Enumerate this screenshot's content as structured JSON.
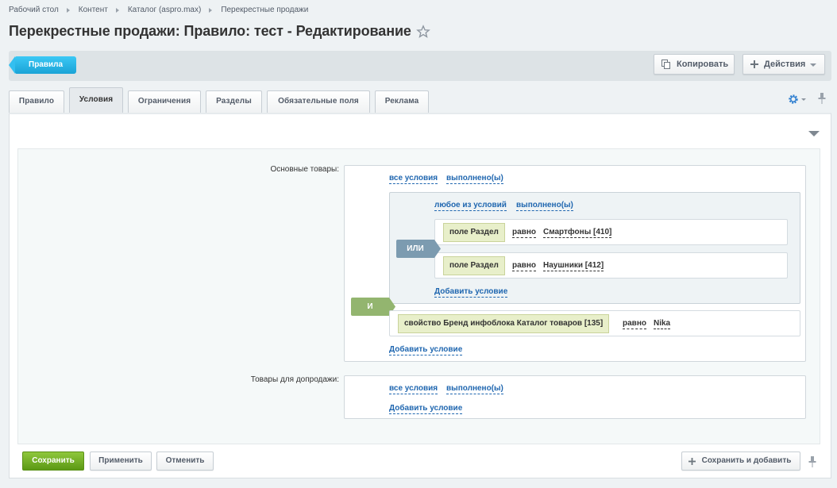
{
  "breadcrumbs": [
    "Рабочий стол",
    "Контент",
    "Каталог (aspro.max)",
    "Перекрестные продажи"
  ],
  "page_title": "Перекрестные продажи: Правило: тест - Редактирование",
  "toolbar": {
    "back_label": "Правила",
    "copy_label": "Копировать",
    "actions_label": "Действия"
  },
  "tabs": [
    "Правило",
    "Условия",
    "Ограничения",
    "Разделы",
    "Обязательные поля",
    "Реклама"
  ],
  "active_tab": "Условия",
  "main_products": {
    "label": "Основные товары:",
    "all_conditions": "все условия",
    "fulfilled": "выполнено(ы)",
    "group": {
      "any_of": "любое из условий",
      "fulfilled": "выполнено(ы)",
      "or_label": "ИЛИ",
      "rows": [
        {
          "field": "поле Раздел",
          "operator": "равно",
          "value": "Смартфоны [410]"
        },
        {
          "field": "поле Раздел",
          "operator": "равно",
          "value": "Наушники [412]"
        }
      ],
      "add_condition": "Добавить условие"
    },
    "and_label": "И",
    "brand_row": {
      "field": "свойство Бренд инфоблока Каталог товаров [135]",
      "operator": "равно",
      "value": "Nika"
    },
    "add_condition": "Добавить условие"
  },
  "upsell_products": {
    "label": "Товары для допродажи:",
    "all_conditions": "все условия",
    "fulfilled": "выполнено(ы)",
    "add_condition": "Добавить условие"
  },
  "buttons": {
    "save": "Сохранить",
    "apply": "Применить",
    "cancel": "Отменить",
    "save_and_add": "Сохранить и добавить"
  }
}
